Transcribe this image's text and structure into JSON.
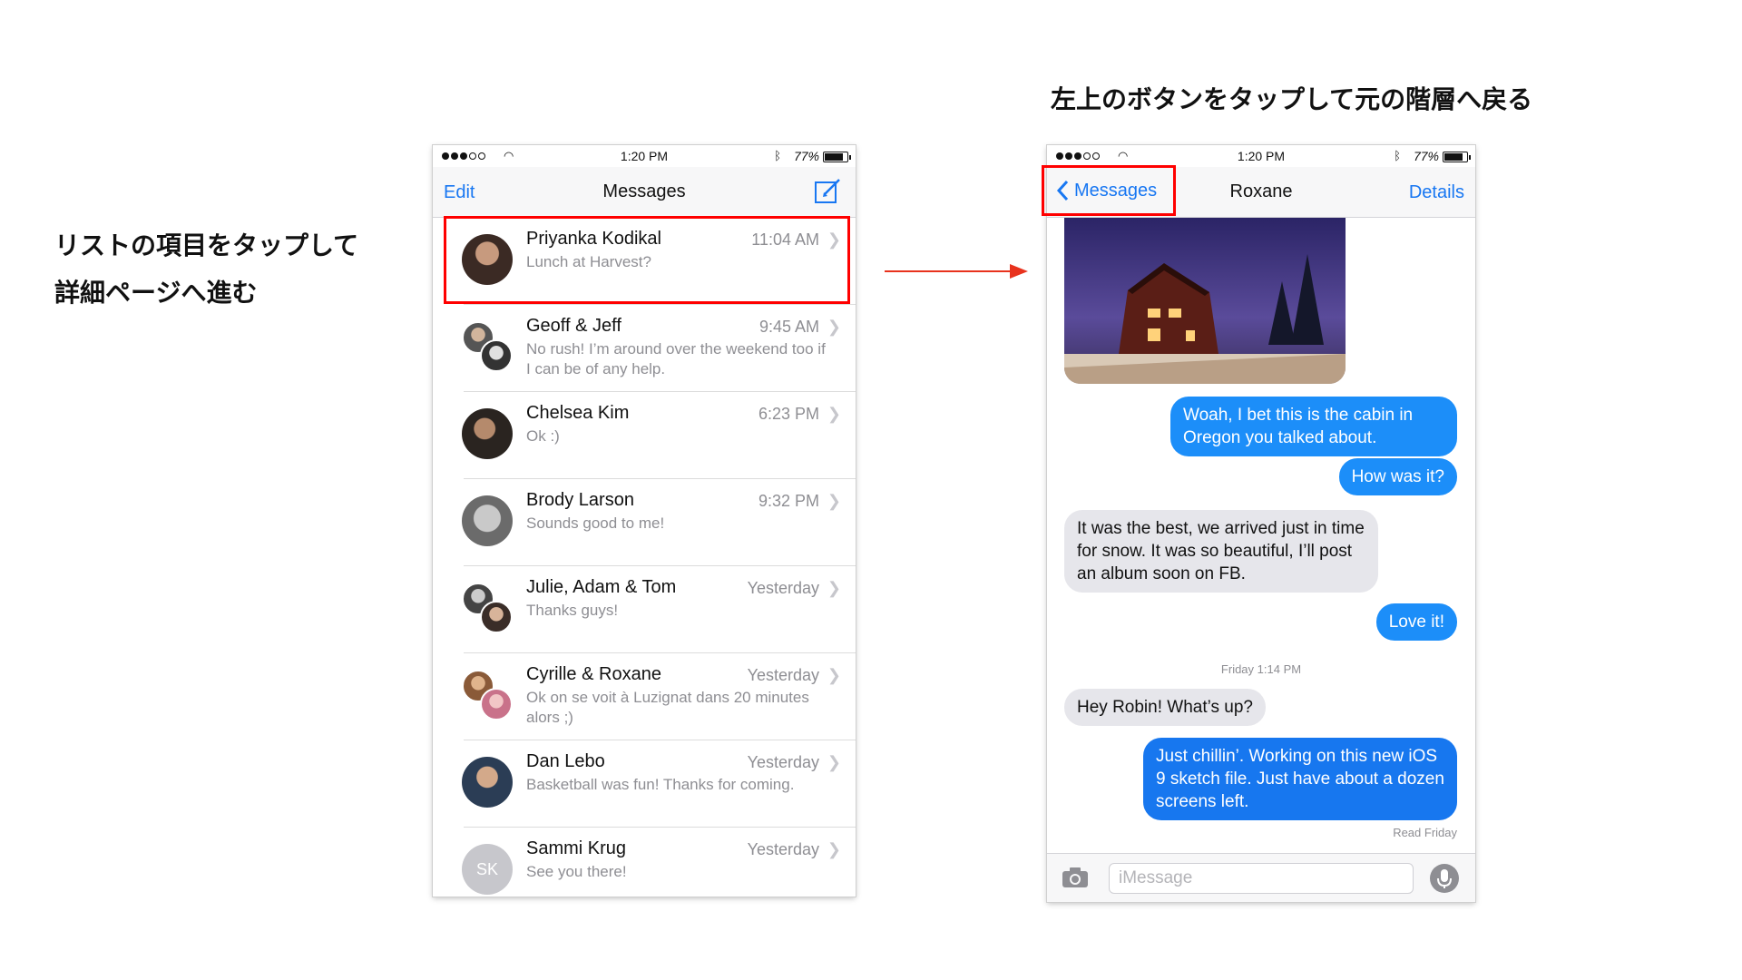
{
  "captions": {
    "left_line1": "リストの項目をタップして",
    "left_line2": "詳細ページへ進む",
    "right": "左上のボタンをタップして元の階層へ戻る"
  },
  "status_bar": {
    "time": "1:20 PM",
    "battery_pct": "77%",
    "battery_level": 0.77
  },
  "list_screen": {
    "nav_left": "Edit",
    "nav_title": "Messages",
    "compose_icon": "compose-icon",
    "conversations": [
      {
        "name": "Priyanka Kodikal",
        "time": "11:04 AM",
        "preview": "Lunch at Harvest?"
      },
      {
        "name": "Geoff & Jeff",
        "time": "9:45 AM",
        "preview": "No rush! I’m around over the weekend too if I can be of any help."
      },
      {
        "name": "Chelsea Kim",
        "time": "6:23 PM",
        "preview": "Ok :)"
      },
      {
        "name": "Brody Larson",
        "time": "9:32 PM",
        "preview": "Sounds good to me!"
      },
      {
        "name": "Julie, Adam & Tom",
        "time": "Yesterday",
        "preview": "Thanks guys!"
      },
      {
        "name": "Cyrille & Roxane",
        "time": "Yesterday",
        "preview": "Ok on se voit à Luzignat dans 20 minutes alors ;)"
      },
      {
        "name": "Dan Lebo",
        "time": "Yesterday",
        "preview": "Basketball was fun! Thanks for coming."
      },
      {
        "name": "Sammi Krug",
        "time": "Yesterday",
        "preview": "See you there!",
        "initials": "SK"
      }
    ]
  },
  "chat_screen": {
    "back_label": "Messages",
    "title": "Roxane",
    "details": "Details",
    "messages": [
      {
        "dir": "out",
        "text": "Woah, I bet this is the cabin in Oregon you talked about."
      },
      {
        "dir": "out",
        "text": "How was it?"
      },
      {
        "dir": "in",
        "text": "It was the best, we arrived just in time for snow. It was so beautiful, I’ll post an album soon on FB."
      },
      {
        "dir": "out",
        "text": "Love it!"
      },
      {
        "dir": "in",
        "text": "Hey Robin! What’s up?"
      },
      {
        "dir": "out",
        "text": "Just chillin’. Working on this new iOS 9 sketch file. Just have about a dozen screens left."
      }
    ],
    "timestamp": "Friday 1:14 PM",
    "read_receipt": "Read Friday",
    "input_placeholder": "iMessage"
  },
  "colors": {
    "ios_blue": "#1877f2",
    "bubble_blue": "#1c8ef9",
    "bubble_gray": "#e6e6eb",
    "highlight_red": "#ff0000",
    "arrow_red": "#e8321d"
  }
}
